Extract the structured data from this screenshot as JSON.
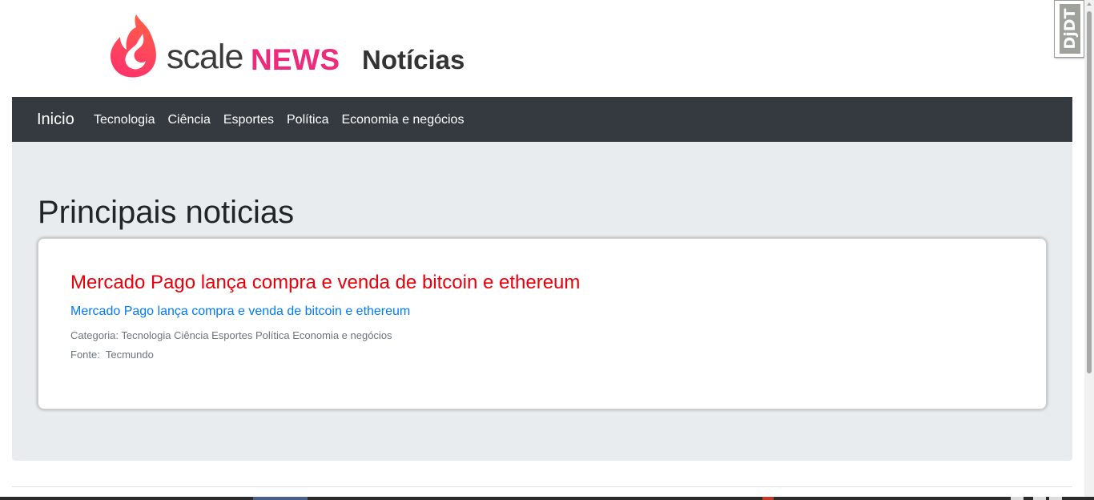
{
  "header": {
    "logo_scale": "scale",
    "logo_news": "NEWS",
    "logo_section": "Notícias"
  },
  "debug_toolbar": {
    "label": "DjDT"
  },
  "navbar": {
    "brand": "Inicio",
    "links": [
      "Tecnologia",
      "Ciência",
      "Esportes",
      "Política",
      "Economia e negócios"
    ]
  },
  "main": {
    "title": "Principais noticias",
    "articles": [
      {
        "title": "Mercado Pago lança compra e venda de bitcoin e ethereum",
        "subtitle": "Mercado Pago lança compra e venda de bitcoin e ethereum",
        "category_line": "Categoria: Tecnologia Ciência Esportes Política Economia e negócios",
        "source_label": "Fonte:",
        "source_value": "Tecmundo"
      }
    ]
  },
  "colors": {
    "navbar_bg": "#343a40",
    "jumbotron_bg": "#e9ecef",
    "brand_pink": "#ee2a7b",
    "headline_red": "#e8000b",
    "link_blue": "#007bff"
  }
}
